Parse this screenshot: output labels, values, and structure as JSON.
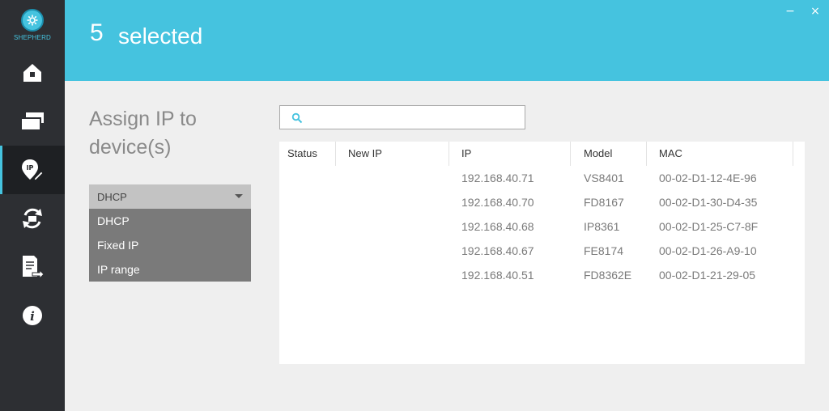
{
  "app": {
    "logo_text": "SHEPHERD"
  },
  "sidebar": {
    "items": [
      {
        "icon": "home-icon"
      },
      {
        "icon": "devices-icon"
      },
      {
        "icon": "assign-ip-icon",
        "active": true
      },
      {
        "icon": "refresh-icon"
      },
      {
        "icon": "export-icon"
      },
      {
        "icon": "info-icon"
      }
    ]
  },
  "header": {
    "count": "5",
    "label": "selected",
    "minimize_label": "−",
    "close_label": "×"
  },
  "panel": {
    "title": "Assign IP to device(s)",
    "dropdown": {
      "selected": "DHCP",
      "options": [
        "DHCP",
        "Fixed IP",
        "IP range"
      ]
    }
  },
  "search": {
    "value": "",
    "placeholder": ""
  },
  "table": {
    "headers": {
      "status": "Status",
      "new_ip": "New IP",
      "ip": "IP",
      "model": "Model",
      "mac": "MAC"
    },
    "rows": [
      {
        "status": "",
        "new_ip": "",
        "ip": "192.168.40.71",
        "model": "VS8401",
        "mac": "00-02-D1-12-4E-96"
      },
      {
        "status": "",
        "new_ip": "",
        "ip": "192.168.40.70",
        "model": "FD8167",
        "mac": "00-02-D1-30-D4-35"
      },
      {
        "status": "",
        "new_ip": "",
        "ip": "192.168.40.68",
        "model": "IP8361",
        "mac": "00-02-D1-25-C7-8F"
      },
      {
        "status": "",
        "new_ip": "",
        "ip": "192.168.40.67",
        "model": "FE8174",
        "mac": "00-02-D1-26-A9-10"
      },
      {
        "status": "",
        "new_ip": "",
        "ip": "192.168.40.51",
        "model": "FD8362E",
        "mac": "00-02-D1-21-29-05"
      }
    ]
  },
  "colors": {
    "accent": "#45c3df",
    "sidebar_bg": "#2d2f33",
    "sidebar_active_bg": "#1e2023",
    "page_bg": "#efefef"
  }
}
